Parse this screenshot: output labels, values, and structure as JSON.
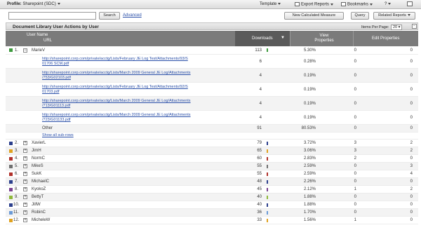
{
  "toolbar": {
    "profile_label": "Profile:",
    "profile_value": "Sharepoint (SDC)",
    "template": "Template",
    "export_reports": "Export Reports",
    "bookmarks": "Bookmarks",
    "help": "?"
  },
  "search": {
    "value": "",
    "button": "Search",
    "advanced": "Advanced"
  },
  "actions": {
    "new_measure": "New Calculated Measure",
    "query": "Query",
    "related_reports": "Related Reports"
  },
  "panel": {
    "title": "Document Library User Actions by User",
    "items_per_page_label": "Items Per Page:",
    "items_per_page_value": "20"
  },
  "columns": {
    "user_name": "User Name",
    "url": "URL",
    "downloads": "Downloads",
    "view_properties": "View Properties",
    "edit_properties": "Edit Properties"
  },
  "expanded_user": {
    "index": "1.",
    "name": "MarieV",
    "downloads": "113",
    "pct": "5.30%",
    "view": "0",
    "edit": "0",
    "color": "#3c9a3c",
    "sub_rows": [
      {
        "url1": "http://sharepoint.corp.com/private/acctg/Lists/February JE Log Test/Attachments/93/S",
        "url2": "01706 SCM.pdf",
        "downloads": "6",
        "pct": "0.28%",
        "view": "0",
        "edit": "0"
      },
      {
        "url1": "http://sharepoint.corp.com/private/acctg/Lists/March 2009 General JE Log/Attachments",
        "url2": "/753/G02103.pdf",
        "downloads": "4",
        "pct": "0.19%",
        "view": "0",
        "edit": "0"
      },
      {
        "url1": "http://sharepoint.corp.com/private/acctg/Lists/February JE Log Test/Attachments/92/S",
        "url2": "01703.pdf",
        "downloads": "4",
        "pct": "0.19%",
        "view": "0",
        "edit": "0"
      },
      {
        "url1": "http://sharepoint.corp.com/private/acctg/Lists/March 2009 General JE Log/Attachments",
        "url2": "/713/G01113.pdf",
        "downloads": "4",
        "pct": "0.19%",
        "view": "0",
        "edit": "0"
      },
      {
        "url1": "http://sharepoint.corp.com/private/acctg/Lists/March 2009 General JE Log/Attachments",
        "url2": "/723/G01133.pdf",
        "downloads": "4",
        "pct": "0.19%",
        "view": "0",
        "edit": "0"
      }
    ],
    "other": {
      "label": "Other",
      "downloads": "91",
      "pct": "80.53%",
      "view": "0",
      "edit": "0"
    },
    "show_all": "Show all sub-rows"
  },
  "users": [
    {
      "index": "2.",
      "name": "XavierL",
      "downloads": "79",
      "pct": "3.72%",
      "view": "3",
      "edit": "2",
      "color": "#2b3f8c"
    },
    {
      "index": "3.",
      "name": "JimH",
      "downloads": "65",
      "pct": "3.06%",
      "view": "3",
      "edit": "2",
      "color": "#e0a21f"
    },
    {
      "index": "4.",
      "name": "NormC",
      "downloads": "60",
      "pct": "2.83%",
      "view": "2",
      "edit": "0",
      "color": "#b0302a"
    },
    {
      "index": "5.",
      "name": "MikeS",
      "downloads": "55",
      "pct": "2.59%",
      "view": "0",
      "edit": "3",
      "color": "#6f6f6f"
    },
    {
      "index": "6.",
      "name": "SukK",
      "downloads": "55",
      "pct": "2.59%",
      "view": "0",
      "edit": "4",
      "color": "#b0302a"
    },
    {
      "index": "7.",
      "name": "MichaelC",
      "downloads": "48",
      "pct": "2.26%",
      "view": "0",
      "edit": "0",
      "color": "#2b3f8c"
    },
    {
      "index": "8.",
      "name": "KyokoZ",
      "downloads": "45",
      "pct": "2.12%",
      "view": "1",
      "edit": "2",
      "color": "#7a3f8f"
    },
    {
      "index": "9.",
      "name": "BettyT",
      "downloads": "40",
      "pct": "1.88%",
      "view": "0",
      "edit": "0",
      "color": "#8fb83a"
    },
    {
      "index": "10.",
      "name": "JillW",
      "downloads": "40",
      "pct": "1.88%",
      "view": "0",
      "edit": "0",
      "color": "#2b3f8c"
    },
    {
      "index": "11.",
      "name": "RobinC",
      "downloads": "36",
      "pct": "1.70%",
      "view": "0",
      "edit": "0",
      "color": "#6a9ad6"
    },
    {
      "index": "12.",
      "name": "MicheleW",
      "downloads": "33",
      "pct": "1.56%",
      "view": "1",
      "edit": "0",
      "color": "#e0a21f"
    }
  ]
}
